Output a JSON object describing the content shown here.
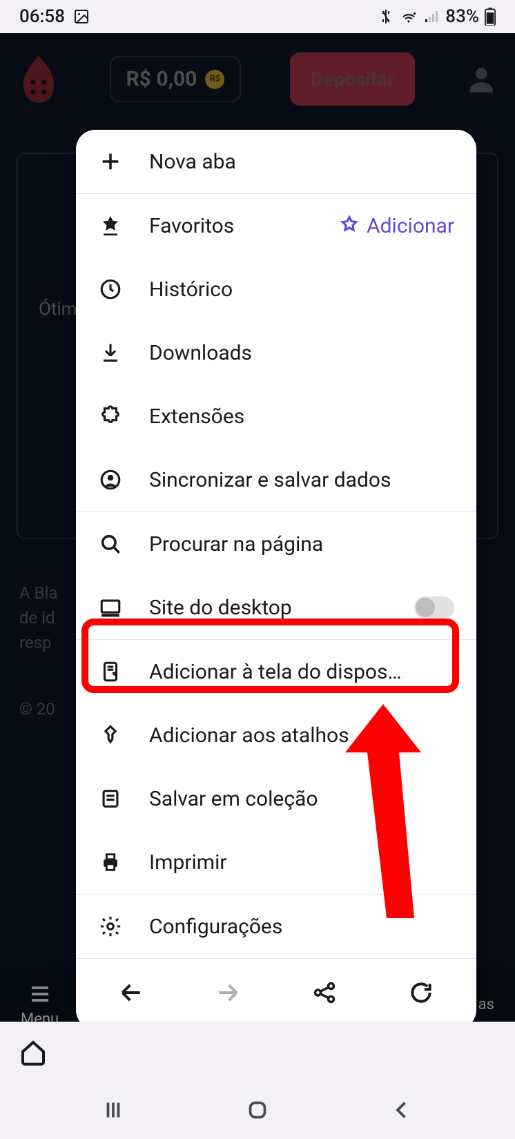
{
  "status_bar": {
    "time": "06:58",
    "battery": "83%"
  },
  "app_bg": {
    "balance": "R$ 0,00",
    "rs_badge": "R$",
    "deposit_label": "Depositar",
    "card_text": "Ótim",
    "disclaimer_line1": "A Bla",
    "disclaimer_line2": "de id",
    "disclaimer_line3": "resp",
    "copyright": "© 20",
    "footer_menu": "Menu",
    "footer_right": "as"
  },
  "menu": {
    "new_tab": "Nova aba",
    "bookmarks": "Favoritos",
    "bookmark_action": "Adicionar",
    "history": "Histórico",
    "downloads": "Downloads",
    "extensions": "Extensões",
    "sync": "Sincronizar e salvar dados",
    "find": "Procurar na página",
    "desktop_site": "Site do desktop",
    "add_home": "Adicionar à tela do dispos…",
    "shortcuts": "Adicionar aos atalhos",
    "collection": "Salvar em coleção",
    "print": "Imprimir",
    "settings": "Configurações"
  }
}
